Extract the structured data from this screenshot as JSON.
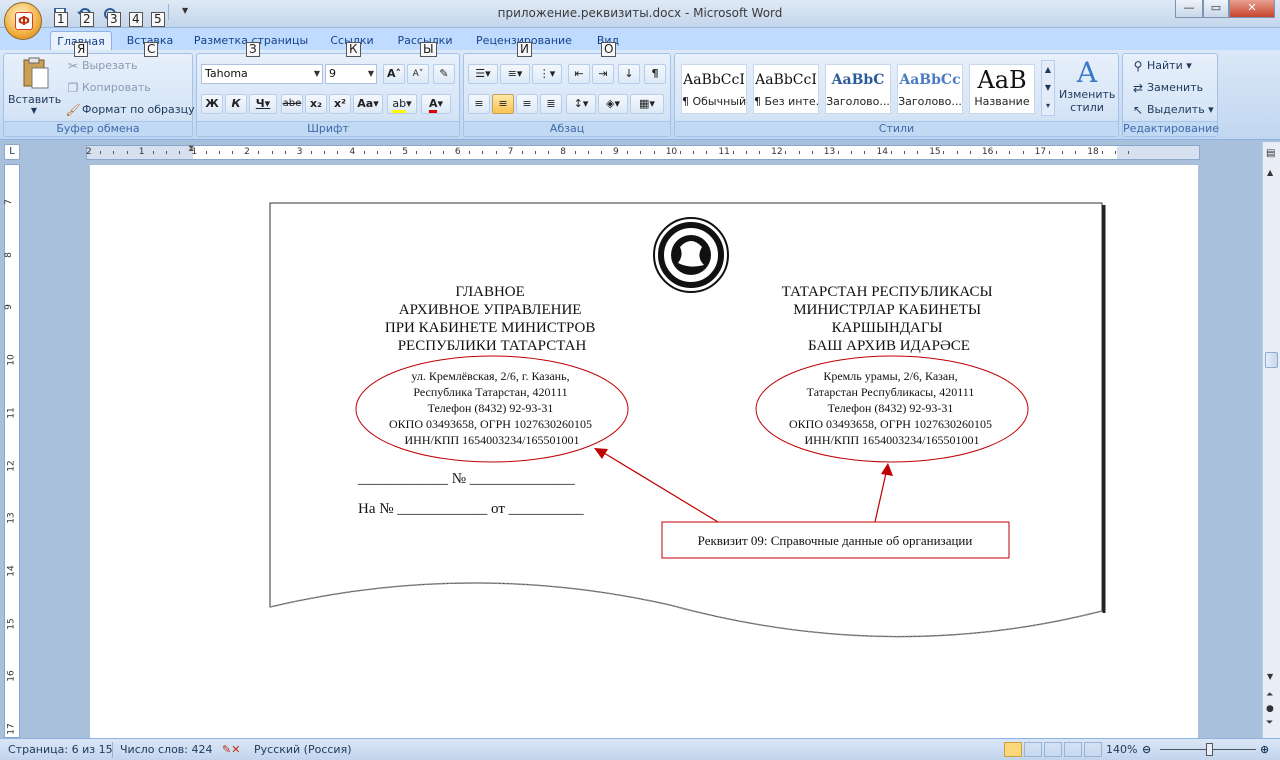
{
  "window": {
    "title": "приложение.реквизиты.docx - Microsoft Word",
    "office_button_letter": "Ф",
    "quick_access_keytips": [
      "1",
      "2",
      "3",
      "4",
      "5"
    ],
    "controls": {
      "minimize": "—",
      "maximize": "▭",
      "close": "✕"
    }
  },
  "tabs": [
    {
      "label": "Главная",
      "keytip": "Я"
    },
    {
      "label": "Вставка",
      "keytip": "С"
    },
    {
      "label": "Разметка страницы",
      "keytip": "З"
    },
    {
      "label": "Ссылки",
      "keytip": "К"
    },
    {
      "label": "Рассылки",
      "keytip": "Ы"
    },
    {
      "label": "Рецензирование",
      "keytip": "И"
    },
    {
      "label": "Вид",
      "keytip": "О"
    }
  ],
  "ribbon": {
    "clipboard": {
      "label": "Буфер обмена",
      "paste": "Вставить",
      "cut": "Вырезать",
      "copy": "Копировать",
      "format_painter": "Формат по образцу"
    },
    "font": {
      "label": "Шрифт",
      "font_name": "Tahoma",
      "font_size": "9",
      "bold": "Ж",
      "italic": "К",
      "underline": "Ч",
      "strike": "abe",
      "subscript": "x₂",
      "superscript": "x²",
      "change_case": "Aa",
      "grow": "A",
      "shrink": "A",
      "highlight": "ab",
      "font_color": "A"
    },
    "paragraph": {
      "label": "Абзац",
      "pilcrow": "¶"
    },
    "styles": {
      "label": "Стили",
      "items": [
        {
          "preview": "AaBbCcI",
          "name": "¶ Обычный"
        },
        {
          "preview": "AaBbCcI",
          "name": "¶ Без инте..."
        },
        {
          "preview": "AaBbC",
          "name": "Заголово..."
        },
        {
          "preview": "AaBbCc",
          "name": "Заголово..."
        },
        {
          "preview": "AaB",
          "name": "Название"
        }
      ],
      "change_styles": "Изменить стили"
    },
    "editing": {
      "label": "Редактирование",
      "find": "Найти",
      "replace": "Заменить",
      "select": "Выделить"
    }
  },
  "document": {
    "left_header": [
      "ГЛАВНОЕ",
      "АРХИВНОЕ УПРАВЛЕНИЕ",
      "ПРИ КАБИНЕТЕ МИНИСТРОВ",
      "РЕСПУБЛИКИ ТАТАРСТАН"
    ],
    "right_header": [
      "ТАТАРСТАН РЕСПУБЛИКАСЫ",
      "МИНИСТРЛАР КАБИНЕТЫ",
      "КАРШЫНДАГЫ",
      "БАШ АРХИВ ИДАРӘСЕ"
    ],
    "left_details": [
      "ул. Кремлёвская, 2/6, г. Казань,",
      "Республика Татарстан, 420111",
      "Телефон (8432) 92-93-31",
      "ОКПО 03493658, ОГРН 1027630260105",
      "ИНН/КПП 1654003234/165501001"
    ],
    "right_details": [
      "Кремль урамы, 2/6, Казан,",
      "Татарстан Республикасы, 420111",
      "Телефон (8432) 92-93-31",
      "ОКПО 03493658, ОГРН 1027630260105",
      "ИНН/КПП 1654003234/165501001"
    ],
    "number_line": "____________ № ______________",
    "ref_line": "На № ____________ от __________",
    "callout": "Реквизит 09: Справочные данные об организации"
  },
  "ruler": {
    "h_numbers": [
      "2",
      "1",
      "1",
      "2",
      "3",
      "4",
      "5",
      "6",
      "7",
      "8",
      "9",
      "10",
      "11",
      "12",
      "13",
      "14",
      "15",
      "16",
      "17",
      "18"
    ],
    "v_numbers": [
      "7",
      "8",
      "9",
      "10",
      "11",
      "12",
      "13",
      "14",
      "15",
      "16",
      "17"
    ]
  },
  "status": {
    "page": "Страница: 6 из 15",
    "words": "Число слов: 424",
    "language": "Русский (Россия)",
    "zoom": "140%"
  },
  "colors": {
    "accent": "#1e395b",
    "callout_red": "#c00000",
    "ribbon_bg": "#dbe8f7"
  }
}
